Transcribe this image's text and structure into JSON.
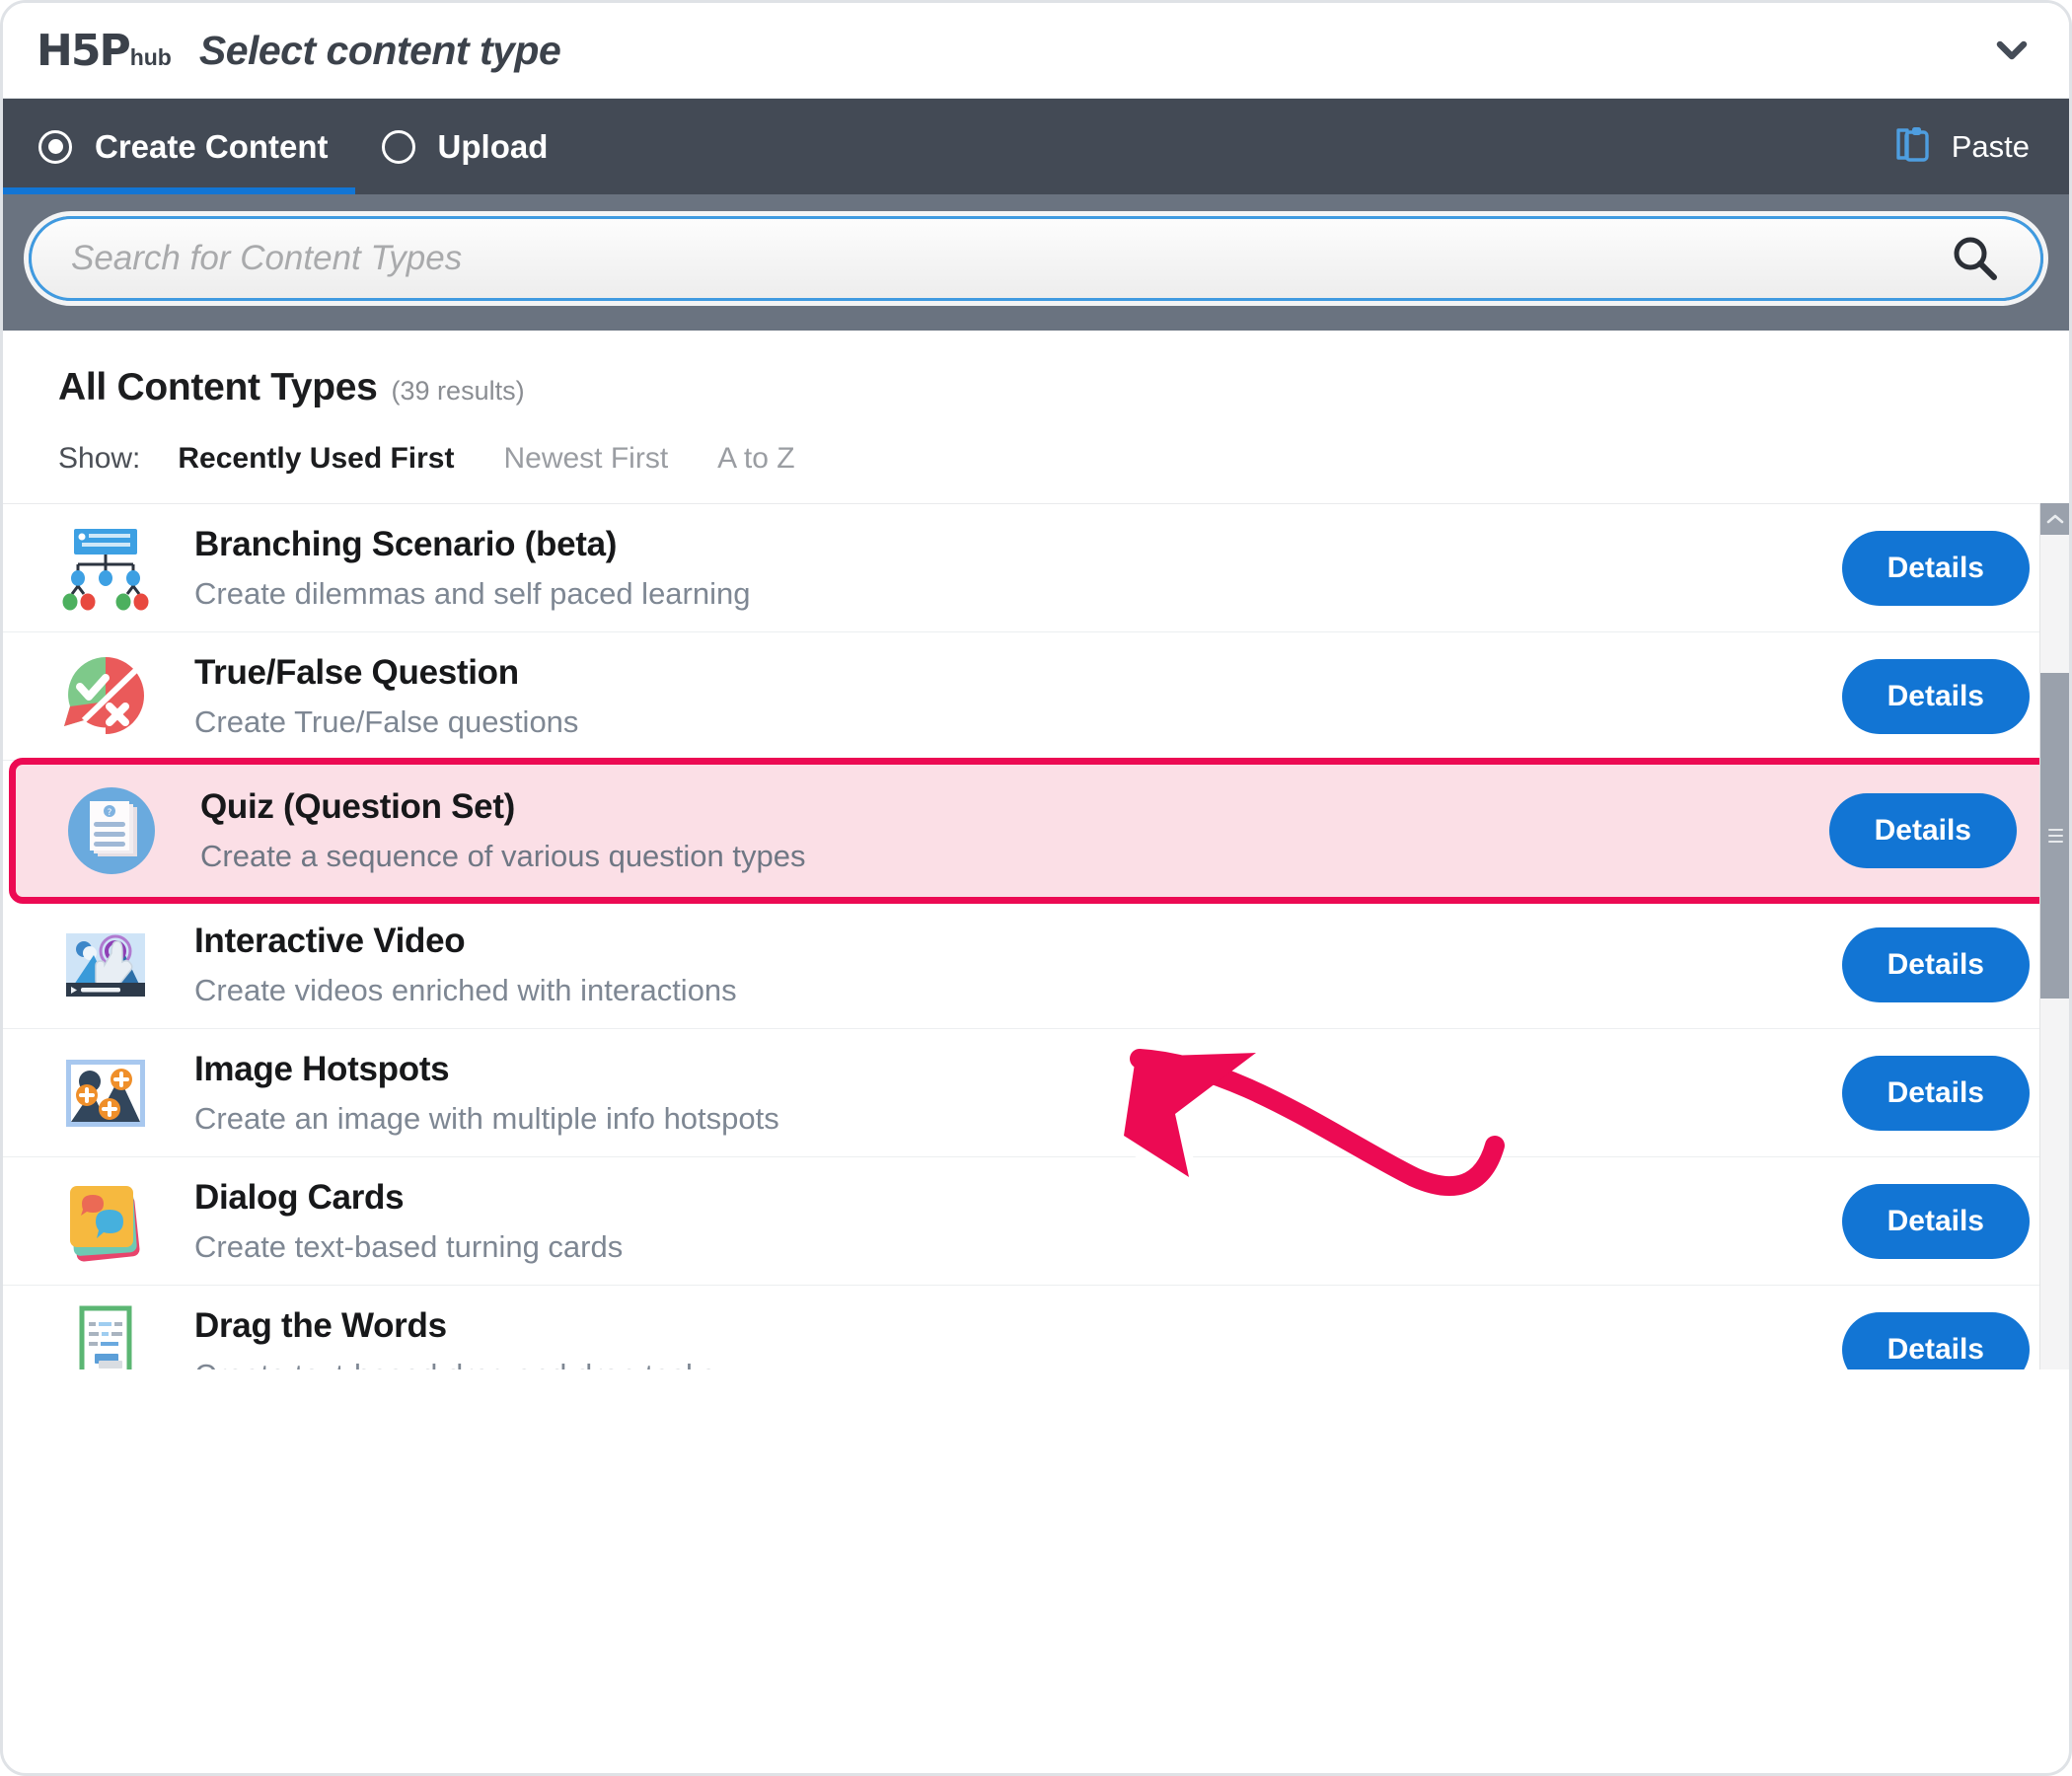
{
  "titlebar": {
    "logo_main": "H5P",
    "logo_sub": "hub",
    "title": "Select content type",
    "chevron_icon": "chevron-down-icon"
  },
  "tabs": {
    "items": [
      {
        "label": "Create Content",
        "selected": true,
        "icon": "radio-selected-icon"
      },
      {
        "label": "Upload",
        "selected": false,
        "icon": "radio-unselected-icon"
      }
    ],
    "paste": {
      "label": "Paste",
      "icon": "clipboard-paste-icon"
    },
    "active_underline_color": "#1275d4"
  },
  "search": {
    "placeholder": "Search for Content Types",
    "value": "",
    "icon": "search-icon",
    "focus_color": "#3f9ae0"
  },
  "results": {
    "title": "All Content Types",
    "count": "(39 results)",
    "show_label": "Show:",
    "sort_options": [
      {
        "label": "Recently Used First",
        "active": true
      },
      {
        "label": "Newest First",
        "active": false
      },
      {
        "label": "A to Z",
        "active": false
      }
    ]
  },
  "content_types": [
    {
      "title": "Branching Scenario (beta)",
      "description": "Create dilemmas and self paced learning",
      "icon": "branching-scenario-icon",
      "details_label": "Details",
      "highlighted": false
    },
    {
      "title": "True/False Question",
      "description": "Create True/False questions",
      "icon": "true-false-question-icon",
      "details_label": "Details",
      "highlighted": false
    },
    {
      "title": "Quiz (Question Set)",
      "description": "Create a sequence of various question types",
      "icon": "quiz-question-set-icon",
      "details_label": "Details",
      "highlighted": true
    },
    {
      "title": "Interactive Video",
      "description": "Create videos enriched with interactions",
      "icon": "interactive-video-icon",
      "details_label": "Details",
      "highlighted": false
    },
    {
      "title": "Image Hotspots",
      "description": "Create an image with multiple info hotspots",
      "icon": "image-hotspots-icon",
      "details_label": "Details",
      "highlighted": false
    },
    {
      "title": "Dialog Cards",
      "description": "Create text-based turning cards",
      "icon": "dialog-cards-icon",
      "details_label": "Details",
      "highlighted": false
    },
    {
      "title": "Drag the Words",
      "description": "Create text-based drag and drop tasks",
      "icon": "drag-the-words-icon",
      "details_label": "Details",
      "highlighted": false
    }
  ],
  "annotation": {
    "arrow_icon": "curved-arrow-annotation",
    "color": "#ec0a53",
    "points_to": "Quiz (Question Set)"
  },
  "scrollbar": {
    "up_arrow_icon": "scroll-up-arrow-icon",
    "thumb_icon": "scrollbar-thumb"
  },
  "colors": {
    "accent_blue": "#1275d4",
    "tabbar_bg": "#434a55",
    "searchstrip_bg": "#6a7380",
    "highlight_border": "#ec0a53",
    "highlight_fill": "#fbdfe6"
  }
}
